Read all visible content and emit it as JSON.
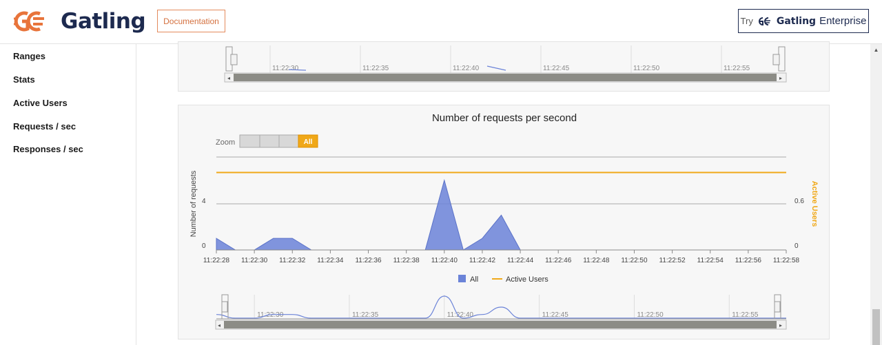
{
  "header": {
    "brand": "Gatling",
    "documentation_label": "Documentation",
    "enterprise_try": "Try",
    "enterprise_brand": "Gatling",
    "enterprise_suffix": "Enterprise"
  },
  "sidebar": {
    "items": [
      {
        "label": "Ranges"
      },
      {
        "label": "Stats"
      },
      {
        "label": "Active Users"
      },
      {
        "label": "Requests / sec"
      },
      {
        "label": "Responses / sec"
      }
    ]
  },
  "top_navigator": {
    "ticks": [
      "11:22:30",
      "11:22:35",
      "11:22:40",
      "11:22:45",
      "11:22:50",
      "11:22:55"
    ]
  },
  "chart": {
    "title": "Number of requests per second",
    "zoom_label": "Zoom",
    "zoom_buttons": [
      "",
      "",
      "",
      "All"
    ],
    "y_left_label": "Number of requests",
    "y_right_label": "Active Users",
    "y_left_ticks": [
      "0",
      "4"
    ],
    "y_right_ticks": [
      "0",
      "0.6"
    ],
    "x_ticks": [
      "11:22:28",
      "11:22:30",
      "11:22:32",
      "11:22:34",
      "11:22:36",
      "11:22:38",
      "11:22:40",
      "11:22:42",
      "11:22:44",
      "11:22:46",
      "11:22:48",
      "11:22:50",
      "11:22:52",
      "11:22:54",
      "11:22:56",
      "11:22:58"
    ],
    "legend": [
      {
        "label": "All",
        "color": "#6b83d8"
      },
      {
        "label": "Active Users",
        "color": "#f0a818"
      }
    ],
    "navigator_ticks": [
      "11:22:30",
      "11:22:35",
      "11:22:40",
      "11:22:45",
      "11:22:50",
      "11:22:55"
    ]
  },
  "chart_data": {
    "type": "area",
    "title": "Number of requests per second",
    "xlabel": "",
    "ylabel": "Number of requests",
    "y2label": "Active Users",
    "x": [
      "11:22:28",
      "11:22:29",
      "11:22:30",
      "11:22:31",
      "11:22:32",
      "11:22:33",
      "11:22:34",
      "11:22:35",
      "11:22:36",
      "11:22:37",
      "11:22:38",
      "11:22:39",
      "11:22:40",
      "11:22:41",
      "11:22:42",
      "11:22:43",
      "11:22:44",
      "11:22:45",
      "11:22:46",
      "11:22:47",
      "11:22:48",
      "11:22:49",
      "11:22:50",
      "11:22:51",
      "11:22:52",
      "11:22:53",
      "11:22:54",
      "11:22:55",
      "11:22:56",
      "11:22:57",
      "11:22:58"
    ],
    "series": [
      {
        "name": "All",
        "axis": "left",
        "color": "#6b83d8",
        "values": [
          1,
          0,
          0,
          1,
          1,
          0,
          0,
          0,
          0,
          0,
          0,
          0,
          6,
          0,
          1,
          3,
          0,
          0,
          0,
          0,
          0,
          0,
          0,
          0,
          0,
          0,
          0,
          0,
          0,
          0,
          0
        ]
      },
      {
        "name": "Active Users",
        "axis": "right",
        "color": "#f0a818",
        "values": [
          1,
          1,
          1,
          1,
          1,
          1,
          1,
          1,
          1,
          1,
          1,
          1,
          1,
          1,
          1,
          1,
          1,
          1,
          1,
          1,
          1,
          1,
          1,
          1,
          1,
          1,
          1,
          1,
          1,
          1,
          1
        ]
      }
    ],
    "ylim": [
      0,
      8
    ],
    "y2lim": [
      0,
      1.2
    ],
    "grid": true,
    "legend_position": "bottom-center"
  }
}
